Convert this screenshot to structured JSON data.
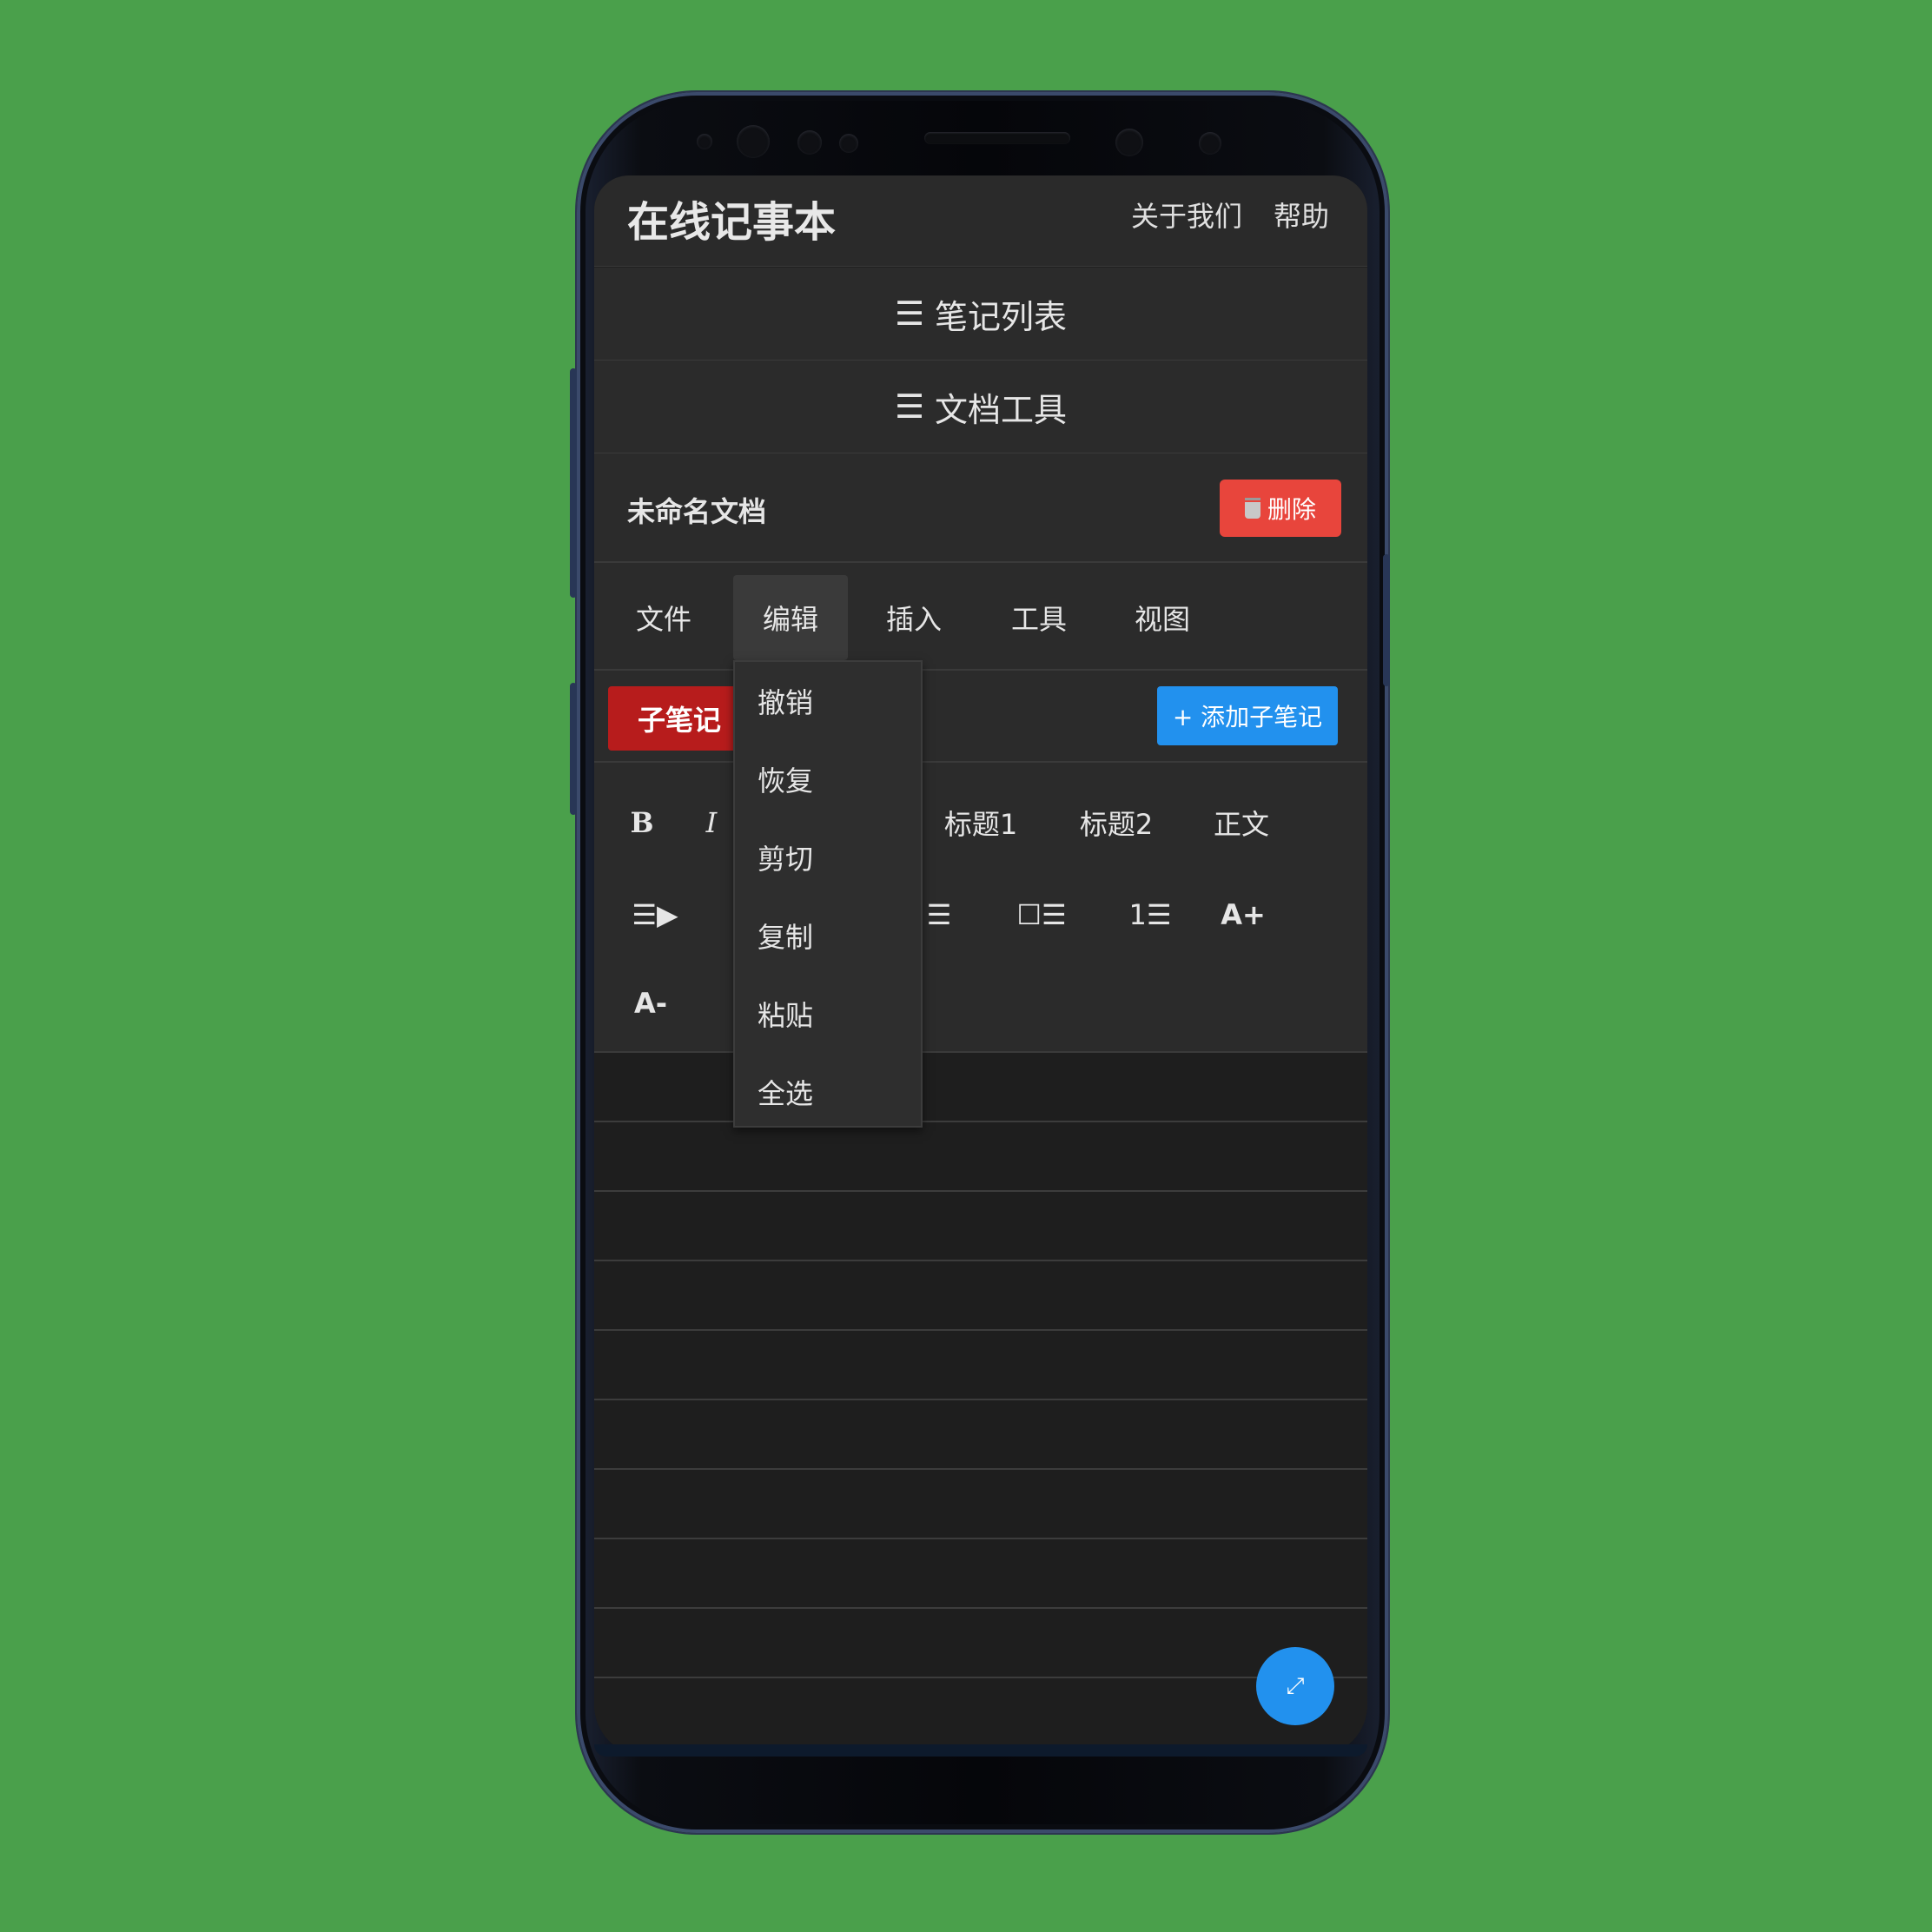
{
  "header": {
    "app_title": "在线记事本",
    "links": [
      "关于我们",
      "帮助"
    ]
  },
  "panels": {
    "note_list": {
      "icon": "☰",
      "label": "笔记列表"
    },
    "doc_tools": {
      "icon": "☰",
      "label": "文档工具"
    }
  },
  "document": {
    "title": "未命名文档",
    "delete_label": "删除",
    "delete_icon": "trash-icon"
  },
  "menubar": {
    "items": [
      "文件",
      "编辑",
      "插入",
      "工具",
      "视图"
    ],
    "active": "编辑"
  },
  "edit_menu": {
    "items": [
      "撤销",
      "恢复",
      "剪切",
      "复制",
      "粘贴",
      "全选"
    ]
  },
  "subnotes": {
    "tab_label": "子笔记",
    "add_label": "+ 添加子笔记"
  },
  "toolbar": {
    "bold": "B",
    "italic": "I",
    "heading1": "标题1",
    "heading2": "标题2",
    "body_text": "正文",
    "indent_icon": "☰▶",
    "bullet_list_icon": "☰",
    "checklist_icon": "☐☰",
    "ordered_list_icon": "1☰",
    "font_increase": "A+",
    "font_decrease": "A-"
  },
  "fab": {
    "icon": "⤢",
    "icon_name": "fullscreen-icon"
  },
  "colors": {
    "background": "#4aa04b",
    "surface": "#2b2b2b",
    "editor": "#1e1e1e",
    "danger": "#e8453c",
    "subnote_tab": "#b71c1c",
    "accent": "#2291ee"
  }
}
